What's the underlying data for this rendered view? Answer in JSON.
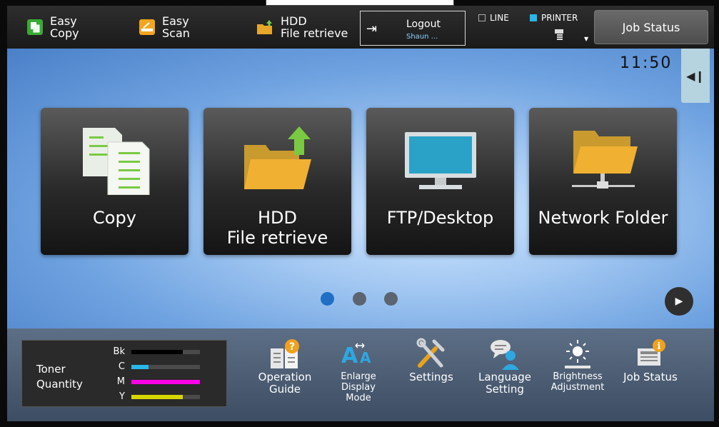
{
  "topbar": {
    "easy_copy": {
      "label": "Easy\nCopy",
      "icon": "easy-copy-icon",
      "color": "#3aaa35"
    },
    "easy_scan": {
      "label": "Easy\nScan",
      "icon": "easy-scan-icon",
      "color": "#f3a51f"
    },
    "hdd_retrieve": {
      "label": "HDD\nFile retrieve",
      "icon": "hdd-folder-icon"
    },
    "logout": {
      "label": "Logout",
      "user": "Shaun ..."
    },
    "line": {
      "label": "LINE"
    },
    "printer": {
      "label": "PRINTER",
      "color": "#29b6e8"
    },
    "job_status": {
      "label": "Job Status"
    }
  },
  "main": {
    "clock": "11:50",
    "tiles": [
      {
        "label": "Copy",
        "icon": "copy-icon"
      },
      {
        "label": "HDD\nFile retrieve",
        "icon": "hdd-folder-upload-icon"
      },
      {
        "label": "FTP/Desktop",
        "icon": "monitor-icon"
      },
      {
        "label": "Network Folder",
        "icon": "network-folder-icon"
      }
    ],
    "pages": 3,
    "active_page": 1
  },
  "bottom": {
    "toner": {
      "title": "Toner\nQuantity",
      "levels": [
        {
          "code": "Bk",
          "level": 0.75,
          "color": "#000000"
        },
        {
          "code": "C",
          "level": 0.25,
          "color": "#29b6e8"
        },
        {
          "code": "M",
          "level": 1.0,
          "color": "#ff00e6"
        },
        {
          "code": "Y",
          "level": 0.75,
          "color": "#d6d600"
        }
      ]
    },
    "items": [
      {
        "label": "Operation\nGuide",
        "icon": "operation-guide-icon"
      },
      {
        "label": "Enlarge\nDisplay\nMode",
        "icon": "enlarge-display-icon"
      },
      {
        "label": "Settings",
        "icon": "settings-icon"
      },
      {
        "label": "Language\nSetting",
        "icon": "language-setting-icon"
      },
      {
        "label": "Brightness\nAdjustment",
        "icon": "brightness-icon"
      },
      {
        "label": "Job Status",
        "icon": "job-status-icon"
      }
    ]
  }
}
